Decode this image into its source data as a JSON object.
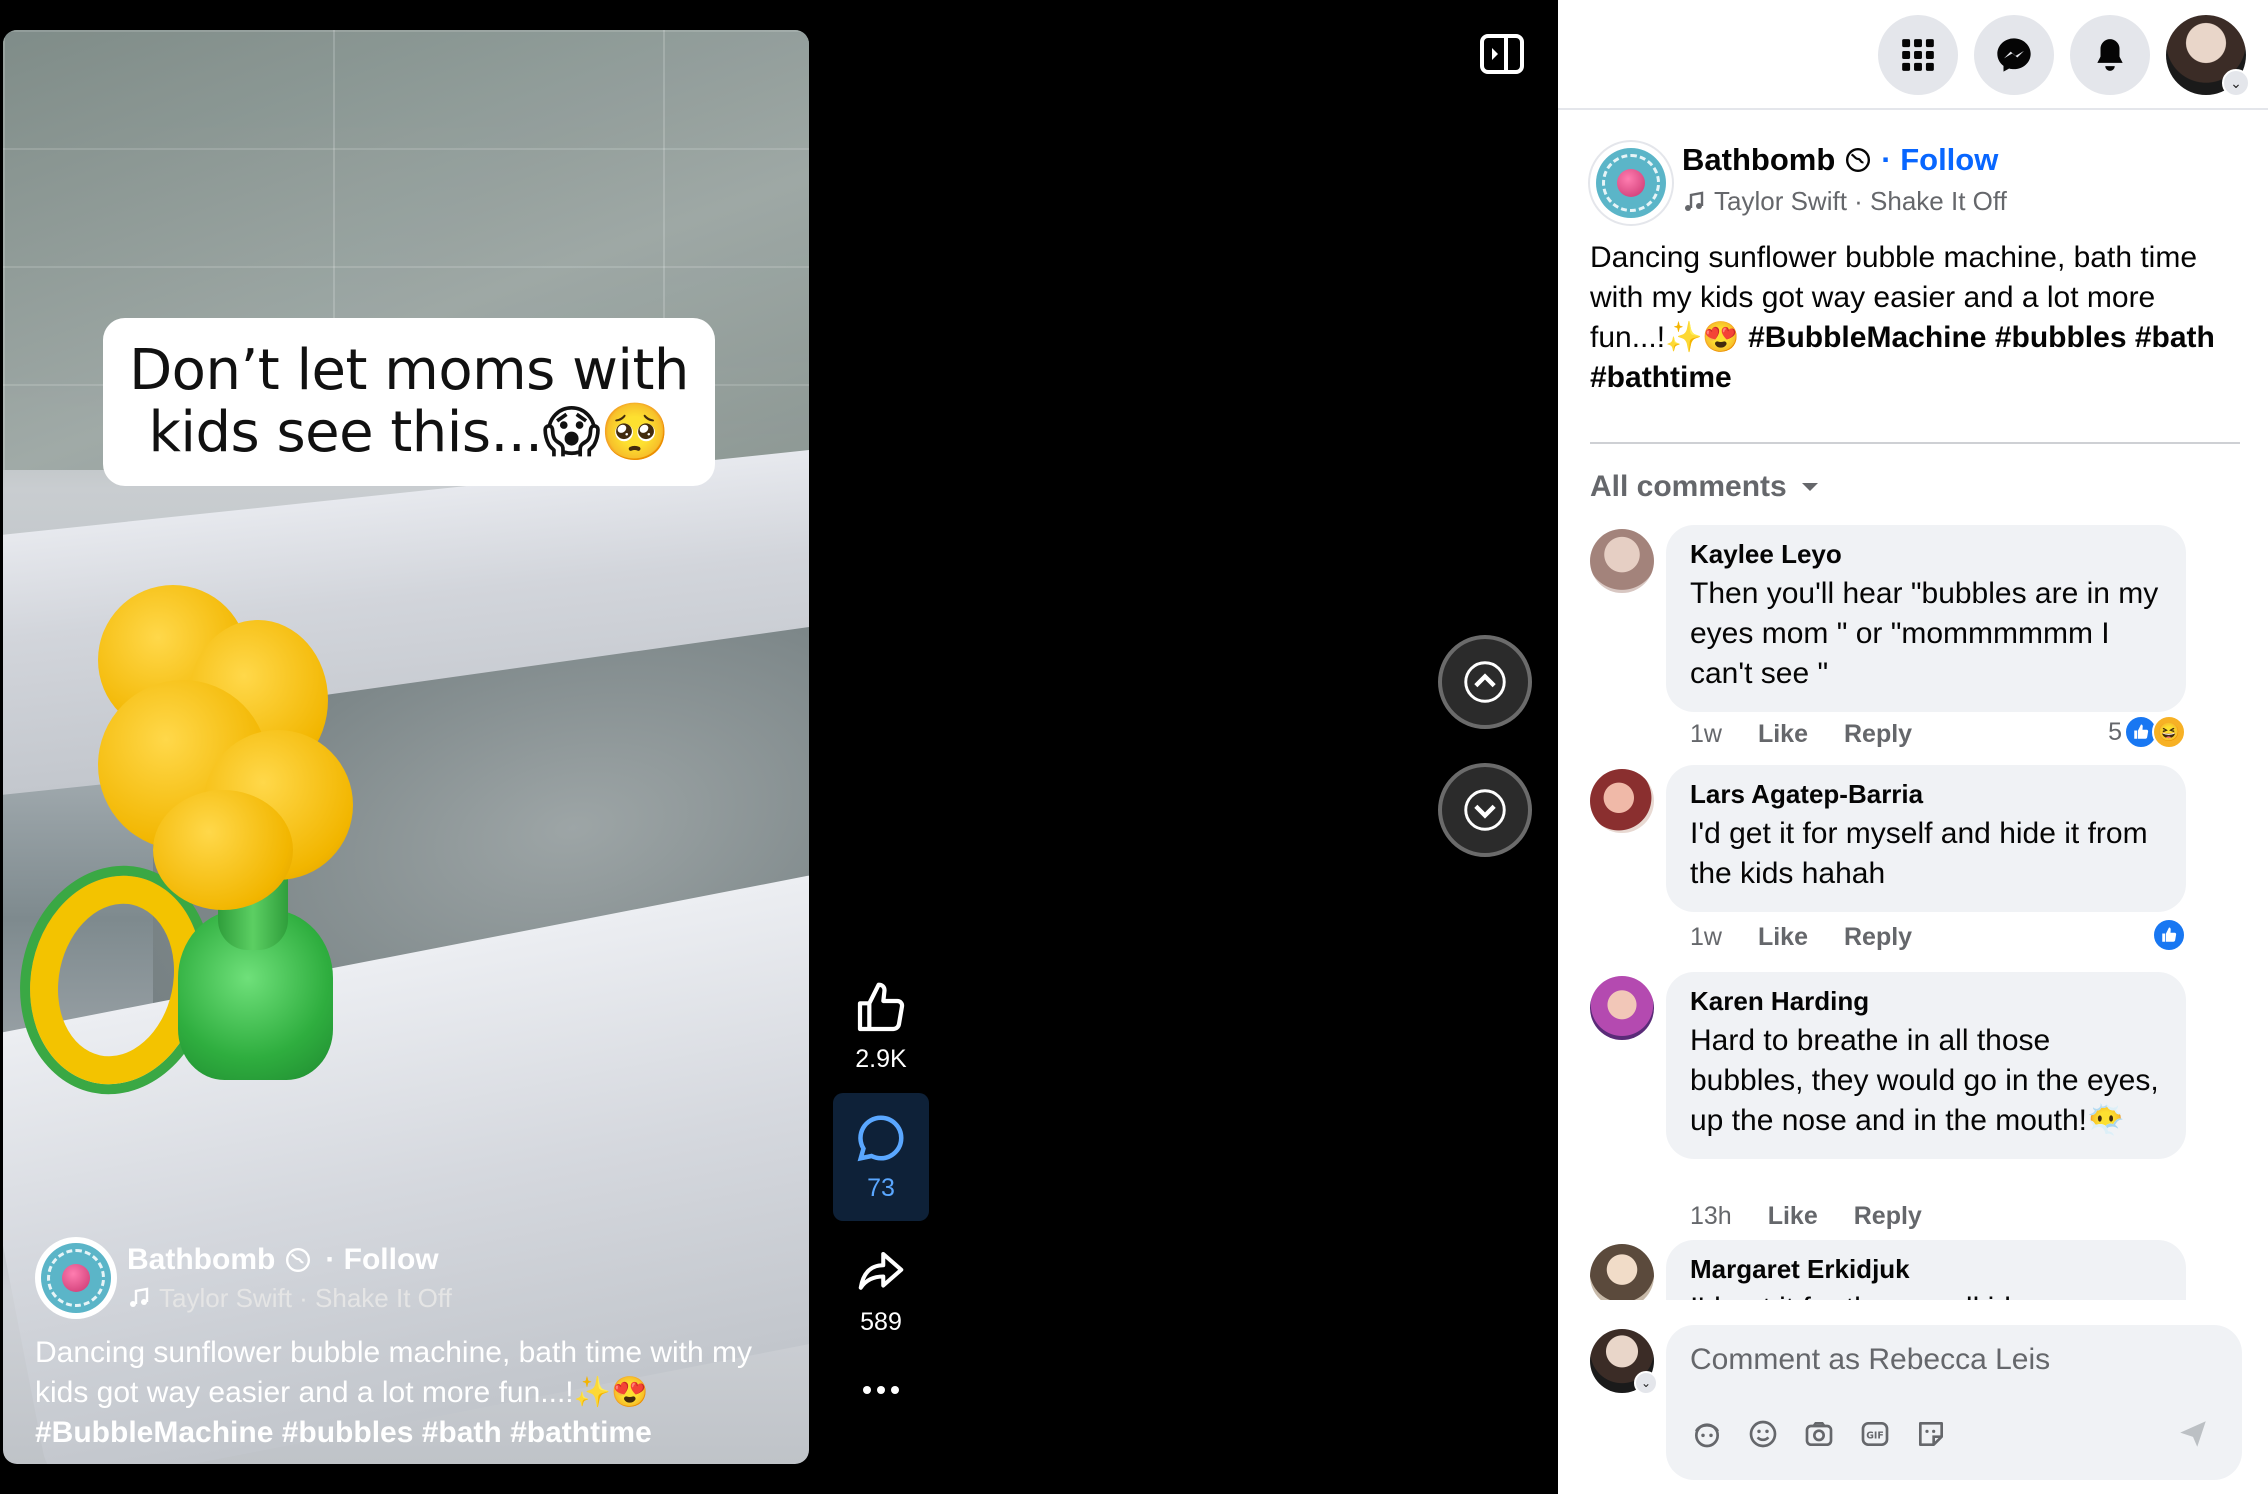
{
  "video": {
    "overlay_text": "Don’t let moms with kids see this...😱🥺",
    "page_name": "Bathbomb",
    "follow_label": "· Follow",
    "music": "Taylor Swift · Shake It Off",
    "description": "Dancing sunflower bubble machine, bath time with my kids got way easier and a lot more fun...!✨😍",
    "hashtags": "#BubbleMachine #bubbles #bath #bathtime"
  },
  "actions": {
    "likes": "2.9K",
    "comments": "73",
    "shares": "589"
  },
  "post": {
    "page_name": "Bathbomb",
    "follow_label": "· Follow",
    "music": "Taylor Swift · Shake It Off",
    "description": "Dancing sunflower bubble machine, bath time with my kids got way easier and a lot more fun...!✨😍",
    "hashtags": "#BubbleMachine #bubbles #bath #bathtime"
  },
  "comments_section": {
    "sort_label": "All comments",
    "items": [
      {
        "name": "Kaylee Leyo",
        "text": "Then you'll hear \"bubbles are in my eyes mom \" or \"mommmmmm I can't see \"",
        "time": "1w",
        "like": "Like",
        "reply": "Reply",
        "reaction_count": "5"
      },
      {
        "name": "Lars Agatep-Barria",
        "text": "I'd get it for myself and hide it from the kids hahah",
        "time": "1w",
        "like": "Like",
        "reply": "Reply"
      },
      {
        "name": "Karen Harding",
        "text": "Hard to breathe in all those bubbles, they would go in the eyes, up the nose and in the mouth!😶‍🌫️",
        "time": "13h",
        "like": "Like",
        "reply": "Reply"
      },
      {
        "name": "Margaret Erkidjuk",
        "text": "I'd get it for the grandkids",
        "time": "",
        "like": "",
        "reply": ""
      }
    ]
  },
  "composer": {
    "placeholder": "Comment as Rebecca Leis"
  },
  "colors": {
    "accent": "#0866ff",
    "comment_bg": "#f0f2f5",
    "secondary_text": "#65676b"
  }
}
